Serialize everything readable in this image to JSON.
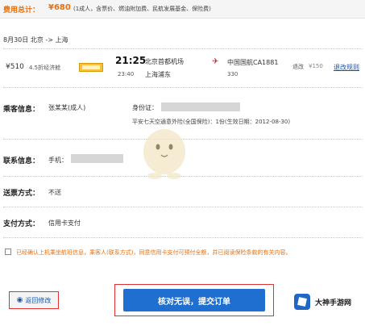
{
  "header": {
    "fee_label": "费用总计：",
    "fee_amount": "¥680",
    "fee_note": "(1成人，含票价、燃油附加费、民航发展基金、保险费)"
  },
  "route": {
    "date": "8月30日",
    "from": "北京",
    "arrow": "->",
    "to": "上海"
  },
  "flight": {
    "price": "¥510",
    "discount": "4.5折经济舱",
    "dep_time": "21:25",
    "dep_airport": "北京首都机场",
    "arr_time": "23:40",
    "arr_airport": "上海浦东",
    "airline": "中国国航CA1881",
    "aircraft": "330",
    "refund_label": "退改",
    "refund_price": "¥150",
    "refund_rule_link": "退改规则"
  },
  "passenger": {
    "label": "乘客信息：",
    "name": "张某某(成人)",
    "id_label": "身份证：",
    "insurance": "平安七天空通意外险(全国保险)：1份(生效日期：2012-08-30)"
  },
  "contact": {
    "label": "联系信息：",
    "phone_label": "手机："
  },
  "delivery": {
    "label": "送票方式：",
    "value": "不送"
  },
  "payment": {
    "label": "支付方式：",
    "value": "信用卡支付"
  },
  "agreement": {
    "text": "已经确认上机乘坐航班信息，乘客人(联系方式)，同意信用卡支付可预付全额，并已阅读保险条款的有关内容。"
  },
  "buttons": {
    "back": "返回修改",
    "submit": "核对无误，提交订单"
  },
  "watermark": {
    "brand": "大神手游网"
  },
  "colors": {
    "accent": "#e8700f",
    "submit": "#1e6fd0",
    "highlight_border": "#e03030"
  }
}
